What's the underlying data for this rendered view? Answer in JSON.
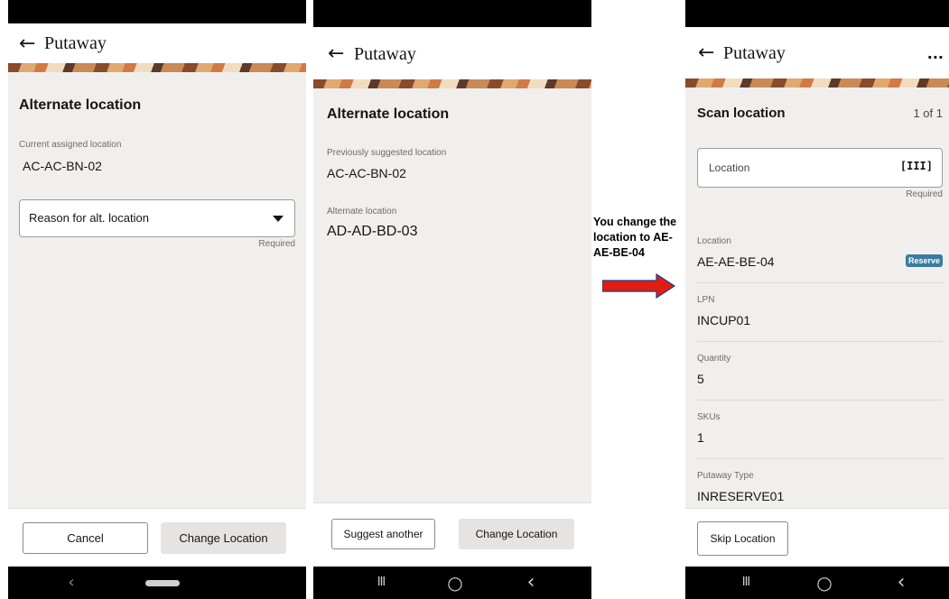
{
  "screen1": {
    "header": {
      "back_icon": "←",
      "title": "Putaway"
    },
    "page_title": "Alternate location",
    "current_label": "Current assigned location",
    "current_value": "AC-AC-BN-02",
    "reason_placeholder": "Reason for alt. location",
    "required_label": "Required",
    "buttons": {
      "cancel": "Cancel",
      "change": "Change Location"
    },
    "nav": {
      "back": "‹"
    }
  },
  "screen2": {
    "header": {
      "back_icon": "←",
      "title": "Putaway"
    },
    "page_title": "Alternate location",
    "previous_label": "Previously suggested location",
    "previous_value": "AC-AC-BN-02",
    "alternate_label": "Alternate location",
    "alternate_value": "AD-AD-BD-03",
    "buttons": {
      "suggest": "Suggest another",
      "change": "Change Location"
    },
    "nav": {
      "recents": "III",
      "home": "○",
      "back": "‹"
    }
  },
  "annotation": {
    "text": "You change the location to AE-AE-BE-04",
    "arrow_color": "#e01e10"
  },
  "screen3": {
    "header": {
      "back_icon": "←",
      "title": "Putaway",
      "more_icon": "..."
    },
    "page_title": "Scan location",
    "pager": "1 of 1",
    "location_placeholder": "Location",
    "scan_icon_glyph": "[III]",
    "required_label": "Required",
    "details": [
      {
        "label": "Location",
        "value": "AE-AE-BE-04"
      },
      {
        "label": "LPN",
        "value": "INCUP01"
      },
      {
        "label": "Quantity",
        "value": "5"
      },
      {
        "label": "SKUs",
        "value": "1"
      },
      {
        "label": "Putaway Type",
        "value": "INRESERVE01"
      }
    ],
    "badge": "Reserve",
    "badge_color": "#3a7ca0",
    "buttons": {
      "skip": "Skip Location"
    },
    "nav": {
      "recents": "III",
      "home": "○",
      "back": "‹"
    }
  }
}
